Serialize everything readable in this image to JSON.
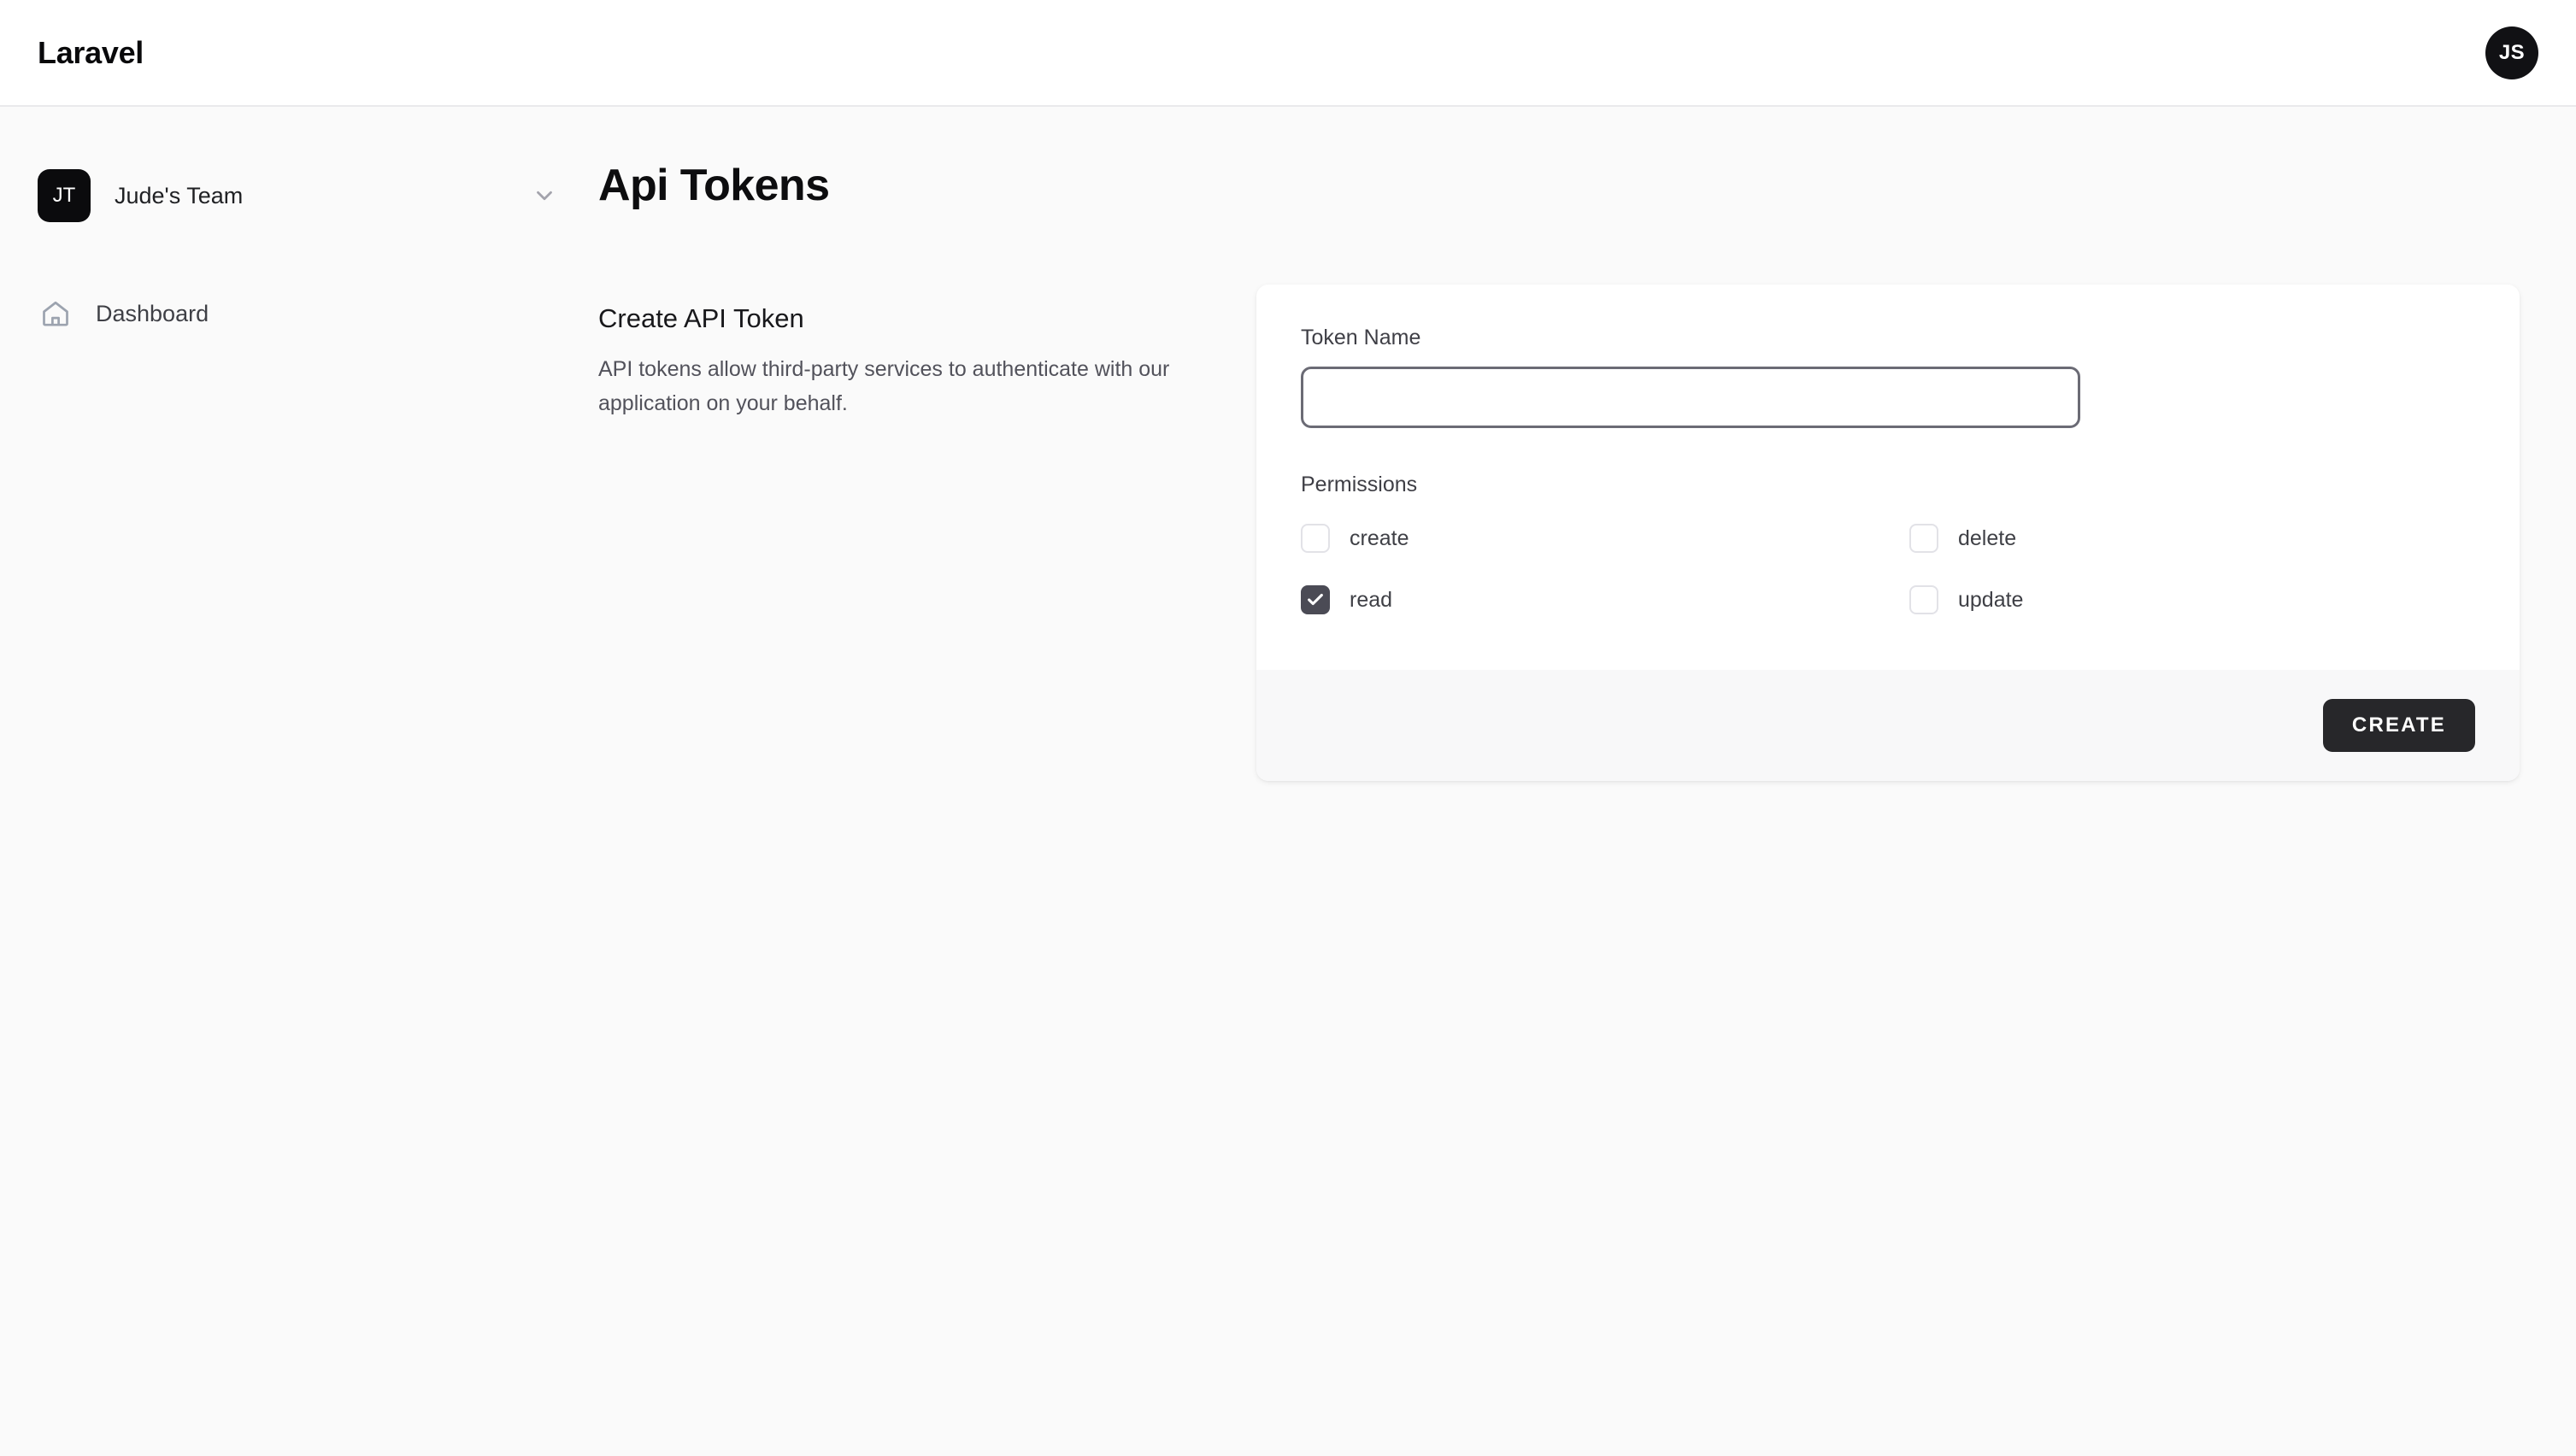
{
  "header": {
    "brand": "Laravel",
    "avatar_initials": "JS"
  },
  "sidebar": {
    "team": {
      "badge_initials": "JT",
      "name": "Jude's Team",
      "chevron_icon": "chevron-down-icon"
    },
    "items": [
      {
        "label": "Dashboard",
        "icon": "home-icon"
      }
    ]
  },
  "main": {
    "page_title": "Api Tokens",
    "section": {
      "title": "Create API Token",
      "description": "API tokens allow third-party services to authenticate with our application on your behalf."
    },
    "form": {
      "token_name_label": "Token Name",
      "token_name_value": "",
      "token_name_placeholder": "",
      "permissions_label": "Permissions",
      "permissions": [
        {
          "label": "create",
          "checked": false
        },
        {
          "label": "delete",
          "checked": false
        },
        {
          "label": "read",
          "checked": true
        },
        {
          "label": "update",
          "checked": false
        }
      ],
      "submit_label": "CREATE"
    }
  },
  "colors": {
    "page_background": "#fafafa",
    "card_background": "#ffffff",
    "card_footer_background": "#f8f8f9",
    "button_background": "#27272a",
    "checkbox_checked": "#4b4b55",
    "input_focus_border": "#6b6b75",
    "avatar_background": "#111114",
    "team_badge_background": "#0b0b0d"
  }
}
